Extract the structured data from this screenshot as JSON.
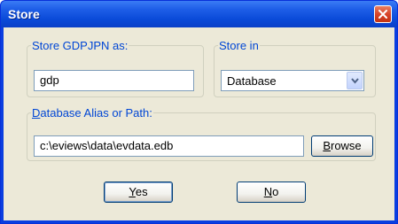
{
  "window": {
    "title": "Store"
  },
  "store_as": {
    "legend": "Store GDPJPN as:",
    "value": "gdp"
  },
  "store_in": {
    "legend": "Store in",
    "selected": "Database"
  },
  "db_path": {
    "legend_first": "D",
    "legend_rest": "atabase Alias or Path:",
    "value": "c:\\eviews\\data\\evdata.edb",
    "browse_first": "B",
    "browse_rest": "rowse"
  },
  "buttons": {
    "yes_first": "Y",
    "yes_rest": "es",
    "no_first": "N",
    "no_rest": "o"
  },
  "icons": {
    "close": "close-icon",
    "dropdown": "chevron-down-icon"
  }
}
